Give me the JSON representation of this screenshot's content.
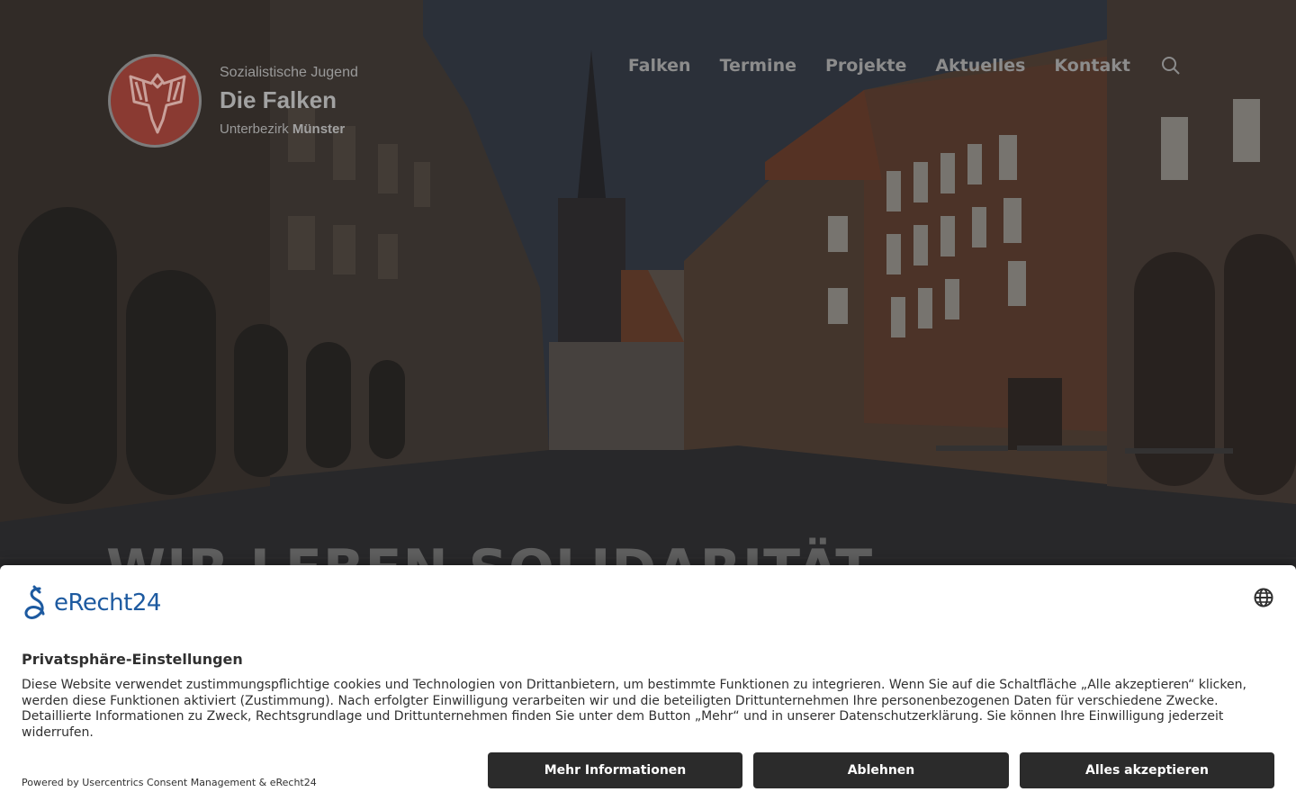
{
  "header": {
    "logo_line1": "Sozialistische Jugend",
    "logo_line2": "Die Falken",
    "logo_line3_prefix": "Unterbezirk",
    "logo_line3_bold": "Münster",
    "nav": [
      "Falken",
      "Termine",
      "Projekte",
      "Aktuelles",
      "Kontakt"
    ],
    "search_icon": "search-icon"
  },
  "hero": {
    "title": "WIR LEBEN SOLIDARITÄT"
  },
  "consent": {
    "brand": "eRecht24",
    "title": "Privatsphäre-Einstellungen",
    "text": "Diese Website verwendet zustimmungspflichtige cookies und Technologien von Drittanbietern, um bestimmte Funktionen zu integrieren. Wenn Sie auf die Schaltfläche „Alle akzeptieren“ klicken, werden diese Funktionen aktiviert (Zustimmung). Nach erfolgter Einwilligung verarbeiten wir und die beteiligten Drittunternehmen Ihre personenbezogenen Daten für verschiedene Zwecke. Detaillierte Informationen zu Zweck, Rechtsgrundlage und Drittunternehmen finden Sie unter dem Button „Mehr“ und in unserer Datenschutzerklärung. Sie können Ihre Einwilligung jederzeit widerrufen.",
    "powered": "Powered by Usercentrics Consent Management & eRecht24",
    "buttons": {
      "more": "Mehr Informationen",
      "decline": "Ablehnen",
      "accept": "Alles akzeptieren"
    },
    "colors": {
      "button_bg": "#2b2b2b",
      "brand": "#1d5aa0"
    }
  }
}
